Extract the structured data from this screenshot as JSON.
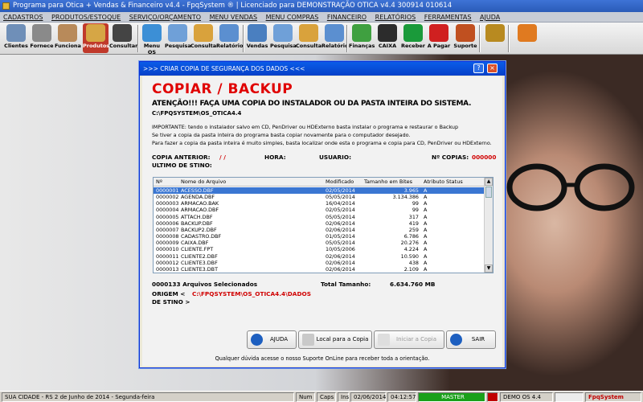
{
  "window": {
    "title": "Programa para Otica + Vendas & Financeiro v4.4 - FpqSystem ® | Licenciado para  DEMONSTRAÇÃO OTICA v4.4 300914 010614"
  },
  "menu": [
    "CADASTROS",
    "PRODUTOS/ESTOQUE",
    "SERVIÇO/ORÇAMENTO",
    "MENU VENDAS",
    "MENU COMPRAS",
    "FINANCEIRO",
    "RELATÓRIOS",
    "FERRAMENTAS",
    "AJUDA"
  ],
  "toolbar": [
    {
      "label": "Clientes",
      "icon": "clients-icon",
      "color": "#6f8fb8"
    },
    {
      "label": "Fornece",
      "icon": "supplier-icon",
      "color": "#8a8a8a"
    },
    {
      "label": "Funciona",
      "icon": "employee-icon",
      "color": "#b88a5a"
    },
    {
      "label": "Produtos",
      "icon": "boxes-icon",
      "color": "#d6a645"
    },
    {
      "label": "Consultar",
      "icon": "barcode-icon",
      "color": "#444444"
    },
    {
      "label": "Menu OS",
      "icon": "os-menu-icon",
      "color": "#3c8fd6"
    },
    {
      "label": "Pesquisa",
      "icon": "search-doc-icon",
      "color": "#6fa0d8"
    },
    {
      "label": "Consulta",
      "icon": "folder-icon",
      "color": "#d9a23c"
    },
    {
      "label": "Relatório",
      "icon": "report-icon",
      "color": "#5b8fd0"
    },
    {
      "label": "Vendas",
      "icon": "monitor-icon",
      "color": "#4a7fc0"
    },
    {
      "label": "Pesquisa",
      "icon": "search-doc-icon",
      "color": "#6fa0d8"
    },
    {
      "label": "Consulta",
      "icon": "folder-icon",
      "color": "#d9a23c"
    },
    {
      "label": "Relatório",
      "icon": "report-icon",
      "color": "#5b8fd0"
    },
    {
      "label": "Finanças",
      "icon": "finance-icon",
      "color": "#3fa040"
    },
    {
      "label": "CAIXA",
      "icon": "cash-icon",
      "color": "#2c2c2c"
    },
    {
      "label": "Receber",
      "icon": "dollar-green-icon",
      "color": "#1a9a3a"
    },
    {
      "label": "A Pagar",
      "icon": "dollar-red-icon",
      "color": "#d02020"
    },
    {
      "label": "Suporte",
      "icon": "support-icon",
      "color": "#c05020"
    },
    {
      "label": "",
      "icon": "coins-icon",
      "color": "#b88a20"
    },
    {
      "label": "",
      "icon": "exit-icon",
      "color": "#e07a20"
    }
  ],
  "dialog": {
    "title": ">>> CRIAR COPIA DE SEGURANÇA DOS DADOS <<<",
    "heading": "COPIAR / BACKUP",
    "warning": "ATENÇÃO!!!   FAÇA UMA COPIA DO INSTALADOR OU DA PASTA INTEIRA DO SISTEMA.",
    "system_path": "C:\\FPQSYSTEM\\OS_OTICA4.4",
    "info_lines": [
      "IMPORTANTE: tendo o instalador salvo em CD, PenDriver ou HDExterno basta instalar o programa e restaurar o Backup",
      "Se tiver a copia da pasta inteira do programa basta copiar novamente para o computador desejado.",
      "Para fazer a copia da pasta inteira é muito simples, basta localizar onde esta o programa e copia para CD, PenDriver ou HDExterno."
    ],
    "copia_anterior_label": "COPIA ANTERIOR:",
    "copia_anterior_value": "/  /",
    "hora_label": "HORA:",
    "usuario_label": "USUARIO:",
    "num_copias_label": "Nº COPIAS:",
    "num_copias_value": "000000",
    "ultimo_destino_label": "ULTIMO DE STINO:",
    "columns": [
      "Nº",
      "Nome do Arquivo",
      "Modificado",
      "Tamanho em Bites",
      "Atributo",
      "Status"
    ],
    "files": [
      {
        "n": "0000001",
        "name": "ACESSO.DBF",
        "mod": "02/05/2014",
        "size": "3.965",
        "attr": "A"
      },
      {
        "n": "0000002",
        "name": "AGENDA.DBF",
        "mod": "05/05/2014",
        "size": "3.134.386",
        "attr": "A"
      },
      {
        "n": "0000003",
        "name": "ARMACAO.BAK",
        "mod": "16/04/2014",
        "size": "99",
        "attr": "A"
      },
      {
        "n": "0000004",
        "name": "ARMACAO.DBF",
        "mod": "02/05/2014",
        "size": "99",
        "attr": "A"
      },
      {
        "n": "0000005",
        "name": "ATTACH.DBF",
        "mod": "05/05/2014",
        "size": "317",
        "attr": "A"
      },
      {
        "n": "0000006",
        "name": "BACKUP.DBF",
        "mod": "02/06/2014",
        "size": "419",
        "attr": "A"
      },
      {
        "n": "0000007",
        "name": "BACKUP2.DBF",
        "mod": "02/06/2014",
        "size": "259",
        "attr": "A"
      },
      {
        "n": "0000008",
        "name": "CADASTRO.DBF",
        "mod": "01/05/2014",
        "size": "6.786",
        "attr": "A"
      },
      {
        "n": "0000009",
        "name": "CAIXA.DBF",
        "mod": "05/05/2014",
        "size": "20.276",
        "attr": "A"
      },
      {
        "n": "0000010",
        "name": "CLIENTE.FPT",
        "mod": "10/05/2006",
        "size": "4.224",
        "attr": "A"
      },
      {
        "n": "0000011",
        "name": "CLIENTE2.DBF",
        "mod": "02/06/2014",
        "size": "10.590",
        "attr": "A"
      },
      {
        "n": "0000012",
        "name": "CLIENTE3.DBF",
        "mod": "02/06/2014",
        "size": "438",
        "attr": "A"
      },
      {
        "n": "0000013",
        "name": "CLIENTE3.DBT",
        "mod": "02/06/2014",
        "size": "2.109",
        "attr": "A"
      }
    ],
    "selected_count": "0000133 Arquivos Selecionados",
    "total_label": "Total Tamanho:",
    "total_value": "6.634.760 MB",
    "origem_label": "ORIGEM  <",
    "origem_value": "C:\\FPQSYSTEM\\OS_OTICA4.4\\DADOS",
    "destino_label": "DE STINO >",
    "btn_ajuda": "AJUDA",
    "btn_local": "Local para a Copia",
    "btn_iniciar": "Iniciar a Copia",
    "btn_sair": "SAIR",
    "footer": "Qualquer dúvida acesse o nosso Suporte OnLine para receber toda a orientação."
  },
  "status": {
    "city": "SUA CIDADE - RS   2 de Junho de 2014 - Segunda-feira",
    "num": "Num",
    "caps": "Caps",
    "ins": "Ins",
    "date": "02/06/2014",
    "time": "04:12:57",
    "user": "MASTER",
    "version": "DEMO OS 4.4",
    "brand": "FpqSystem",
    "accent_green": "#1aa01a",
    "accent_red": "#c00000"
  }
}
